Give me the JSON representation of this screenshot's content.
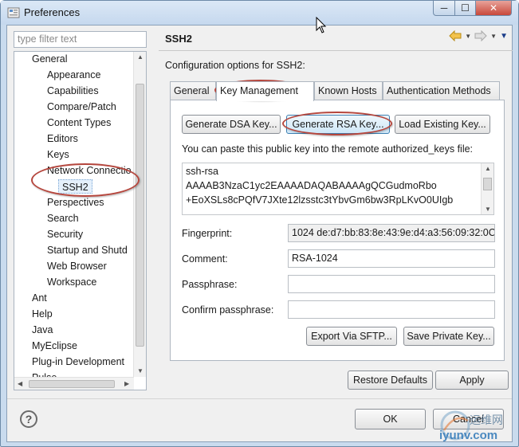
{
  "window": {
    "title": "Preferences",
    "controls": {
      "minimize": "─",
      "maximize": "☐",
      "close": "✕"
    }
  },
  "sidebar": {
    "filter_placeholder": "type filter text",
    "tree": [
      {
        "label": "General"
      },
      {
        "label": "Appearance"
      },
      {
        "label": "Capabilities"
      },
      {
        "label": "Compare/Patch"
      },
      {
        "label": "Content Types"
      },
      {
        "label": "Editors"
      },
      {
        "label": "Keys"
      },
      {
        "label": "Network Connectio"
      },
      {
        "label": "SSH2"
      },
      {
        "label": "Perspectives"
      },
      {
        "label": "Search"
      },
      {
        "label": "Security"
      },
      {
        "label": "Startup and Shutd"
      },
      {
        "label": "Web Browser"
      },
      {
        "label": "Workspace"
      },
      {
        "label": "Ant"
      },
      {
        "label": "Help"
      },
      {
        "label": "Java"
      },
      {
        "label": "MyEclipse"
      },
      {
        "label": "Plug-in Development"
      },
      {
        "label": "Pulse"
      }
    ]
  },
  "page": {
    "title": "SSH2",
    "description": "Configuration options for SSH2:",
    "tabs": [
      {
        "label": "General"
      },
      {
        "label": "Key Management"
      },
      {
        "label": "Known Hosts"
      },
      {
        "label": "Authentication Methods"
      }
    ],
    "key_management": {
      "generate_dsa": "Generate DSA Key...",
      "generate_rsa": "Generate RSA Key...",
      "load_existing": "Load Existing Key...",
      "paste_hint": "You can paste this public key into the remote authorized_keys file:",
      "public_key_lines": [
        "ssh-rsa",
        "AAAAB3NzaC1yc2EAAAADAQABAAAAgQCGudmoRbo",
        "+EoXSLs8cPQfV7JXte12lzsstc3tYbvGm6bw3RpLKvO0UIgb"
      ],
      "fingerprint_label": "Fingerprint:",
      "fingerprint_value": "1024 de:d7:bb:83:8e:43:9e:d4:a3:56:09:32:0C",
      "comment_label": "Comment:",
      "comment_value": "RSA-1024",
      "passphrase_label": "Passphrase:",
      "passphrase_value": "",
      "confirm_label": "Confirm passphrase:",
      "confirm_value": "",
      "export_sftp": "Export Via SFTP...",
      "save_private": "Save Private Key..."
    },
    "restore_defaults": "Restore Defaults",
    "apply": "Apply"
  },
  "footer": {
    "help_icon": "?",
    "ok": "OK",
    "cancel": "Cancel"
  },
  "watermark": {
    "cn": "运维网",
    "url": "iyunv.com"
  },
  "colors": {
    "annotation": "#b5463d",
    "focus_border": "#3c7fb1",
    "title_bar": "#c9dbee"
  }
}
